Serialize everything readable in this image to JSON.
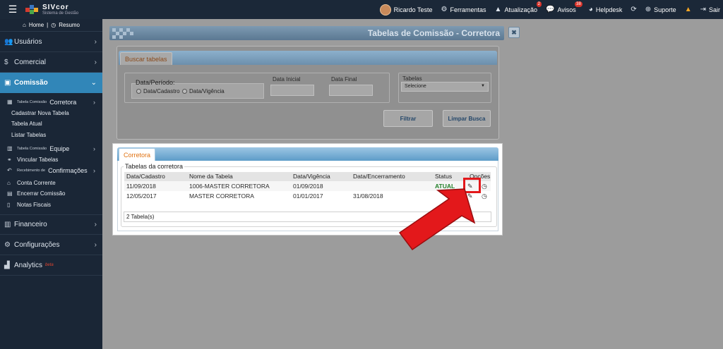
{
  "topbar": {
    "logo_name": "SIVcor",
    "logo_sub": "Sistema de Gestão",
    "user_name": "Ricardo Teste",
    "ferramentas": "Ferramentas",
    "atualizacao": "Atualização",
    "atualizacao_count": "2",
    "avisos": "Avisos",
    "avisos_count": "38",
    "helpdesk": "Helpdesk",
    "suporte": "Suporte",
    "sair": "Sair"
  },
  "sidebar": {
    "home": "Home",
    "resumo": "Resumo",
    "usuarios": "Usuários",
    "comercial": "Comercial",
    "comissao": "Comissão",
    "tabela_comissao_small": "Tabela Comissão",
    "corretora": "Corretora",
    "cadastrar": "Cadastrar Nova Tabela",
    "tabela_atual": "Tabela Atual",
    "listar": "Listar Tabelas",
    "tabela_comissao_small2": "Tabela Comissão",
    "equipe": "Equipe",
    "vincular": "Vincular Tabelas",
    "recebimento_small": "Recebimento de",
    "confirmacoes": "Confirmações",
    "conta_corrente": "Conta Corrente",
    "encerrar": "Encerrar Comissão",
    "notas": "Notas Fiscais",
    "financeiro": "Financeiro",
    "configuracoes": "Configurações",
    "analytics": "Analytics",
    "beta": "beta"
  },
  "window": {
    "title": "Tabelas de Comissão - Corretora",
    "close": "✖"
  },
  "search": {
    "tab": "Buscar tabelas",
    "periodo_label": "Data/Período:",
    "radio_cadastro": "Data/Cadastro",
    "radio_vigencia": "Data/Vigência",
    "data_inicial": "Data Inicial",
    "data_final": "Data Final",
    "tabelas_label": "Tabelas",
    "select_value": "Selecione",
    "filtrar": "Filtrar",
    "limpar": "Limpar Busca"
  },
  "results": {
    "tab": "Corretora",
    "legend": "Tabelas da corretora",
    "columns": [
      "Data/Cadastro",
      "Nome da Tabela",
      "Data/Vigência",
      "Data/Encerramento",
      "Status",
      "Opções"
    ],
    "rows": [
      {
        "cadastro": "11/09/2018",
        "nome": "1006-MASTER CORRETORA",
        "vigencia": "01/09/2018",
        "encerramento": "",
        "status": "ATUAL"
      },
      {
        "cadastro": "12/05/2017",
        "nome": "MASTER CORRETORA",
        "vigencia": "01/01/2017",
        "encerramento": "31/08/2018",
        "status": ""
      }
    ],
    "footer": "2 Tabela(s)"
  },
  "colors": {
    "topbar": "#1b2838",
    "sidebar": "#1a2636",
    "active_menu": "#3186b8",
    "status_green": "#23802a",
    "highlight_red": "#e3181b"
  }
}
